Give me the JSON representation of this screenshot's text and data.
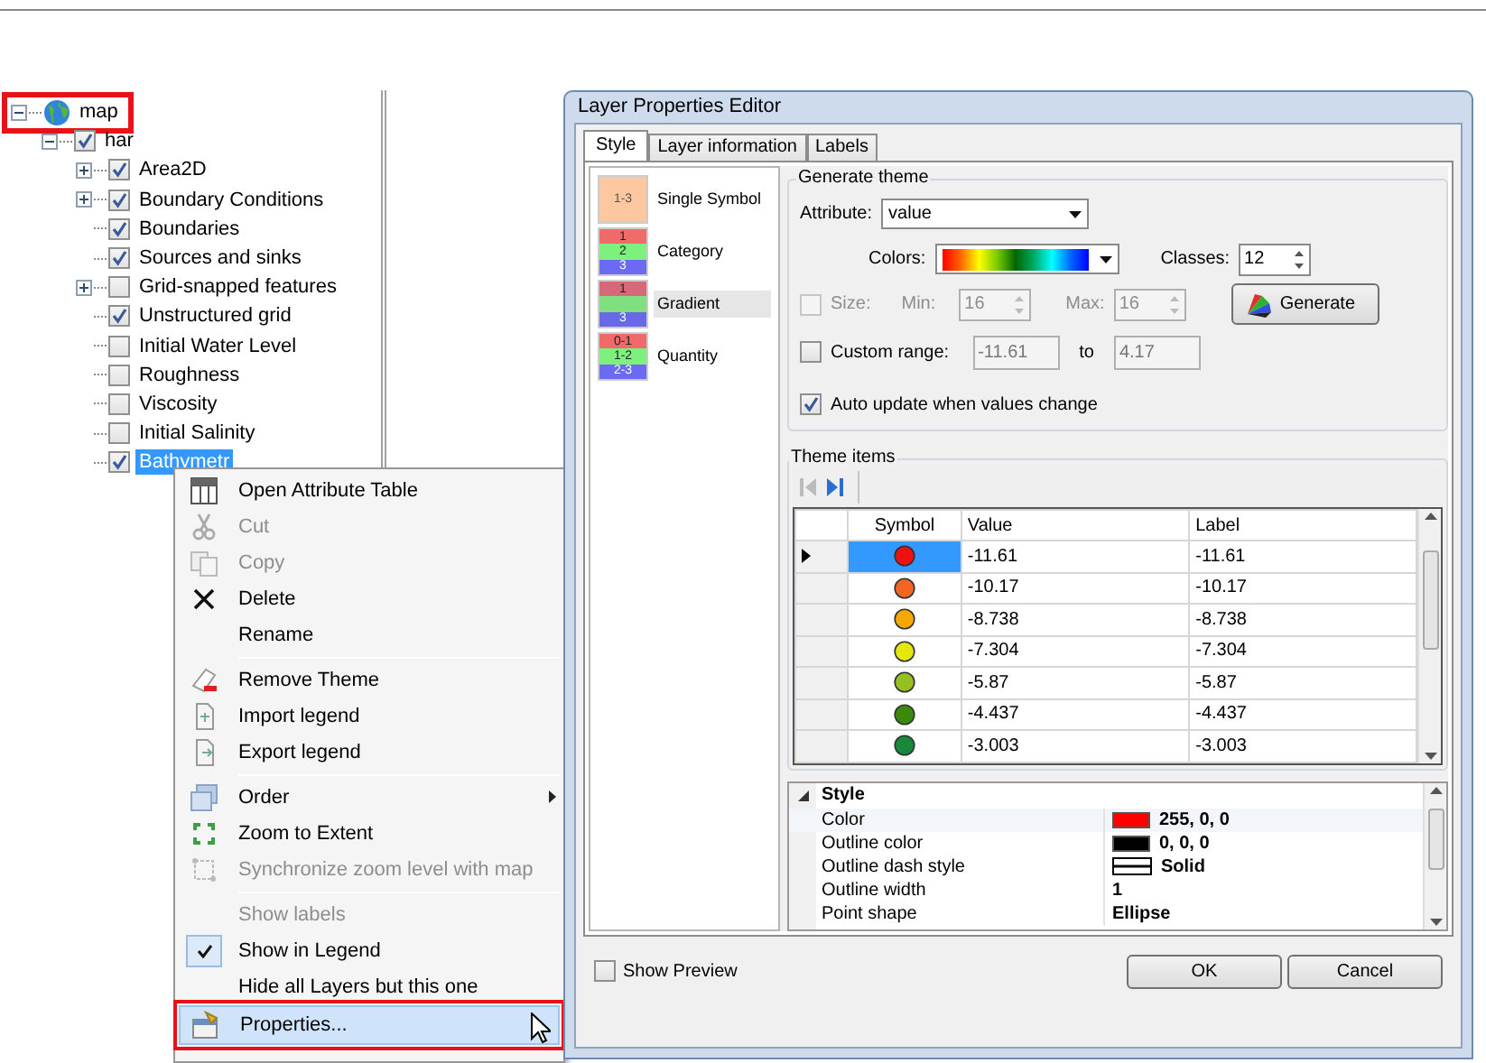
{
  "tree": {
    "nodes": [
      {
        "label": "map",
        "kind": "map",
        "expanded": true,
        "callout": true,
        "children": [
          {
            "label": "har",
            "expanded": true,
            "checked": true,
            "selected": false,
            "children": [
              {
                "label": "Area2D",
                "expanded": false,
                "checked": true,
                "selected": false
              },
              {
                "label": "Boundary Conditions",
                "expanded": false,
                "checked": true,
                "selected": false
              },
              {
                "label": "Boundaries",
                "checked": true,
                "selected": false
              },
              {
                "label": "Sources and sinks",
                "checked": true,
                "selected": false
              },
              {
                "label": "Grid-snapped features",
                "expanded": false,
                "checked": false,
                "selected": false
              },
              {
                "label": "Unstructured grid",
                "checked": true,
                "selected": false
              },
              {
                "label": "Initial Water Level",
                "checked": false,
                "selected": false
              },
              {
                "label": "Roughness",
                "checked": false,
                "selected": false
              },
              {
                "label": "Viscosity",
                "checked": false,
                "selected": false
              },
              {
                "label": "Initial Salinity",
                "checked": false,
                "selected": false
              },
              {
                "label": "Bathymetr",
                "checked": true,
                "selected": true
              }
            ]
          }
        ]
      }
    ]
  },
  "context_menu": {
    "items": [
      {
        "kind": "item",
        "label": "Open Attribute Table",
        "disabled": false,
        "checked": false,
        "selected": false
      },
      {
        "kind": "item",
        "label": "Cut",
        "disabled": true,
        "checked": false,
        "selected": false
      },
      {
        "kind": "item",
        "label": "Copy",
        "disabled": true,
        "checked": false,
        "selected": false
      },
      {
        "kind": "item",
        "label": "Delete",
        "disabled": false,
        "checked": false,
        "selected": false
      },
      {
        "kind": "item",
        "label": "Rename",
        "disabled": false,
        "checked": false,
        "selected": false
      },
      {
        "kind": "separator"
      },
      {
        "kind": "item",
        "label": "Remove Theme",
        "disabled": false,
        "checked": false,
        "selected": false
      },
      {
        "kind": "item",
        "label": "Import legend",
        "disabled": false,
        "checked": false,
        "selected": false
      },
      {
        "kind": "item",
        "label": "Export legend",
        "disabled": false,
        "checked": false,
        "selected": false
      },
      {
        "kind": "separator"
      },
      {
        "kind": "item",
        "label": "Order",
        "disabled": false,
        "checked": false,
        "selected": false,
        "submenu": true
      },
      {
        "kind": "item",
        "label": "Zoom to Extent",
        "disabled": false,
        "checked": false,
        "selected": false
      },
      {
        "kind": "item",
        "label": "Synchronize zoom level with map",
        "disabled": true,
        "checked": false,
        "selected": false
      },
      {
        "kind": "separator"
      },
      {
        "kind": "item",
        "label": "Show labels",
        "disabled": true,
        "checked": false,
        "selected": false
      },
      {
        "kind": "item",
        "label": "Show in Legend",
        "disabled": false,
        "checked": true,
        "selected": false
      },
      {
        "kind": "item",
        "label": "Hide all Layers but this one",
        "disabled": false,
        "checked": false,
        "selected": false
      },
      {
        "kind": "item",
        "label": "Properties...",
        "disabled": false,
        "checked": false,
        "selected": true,
        "callout": true
      }
    ]
  },
  "dialog": {
    "title": "Layer Properties Editor",
    "tabs": [
      {
        "label": "Style",
        "selected": true
      },
      {
        "label": "Layer information",
        "selected": false
      },
      {
        "label": "Labels",
        "selected": false
      }
    ],
    "theme_types": [
      {
        "label": "Single Symbol",
        "kind": "single",
        "swatch": [
          "1-3"
        ],
        "selected": false
      },
      {
        "label": "Category",
        "kind": "category",
        "swatch": [
          "1",
          "2",
          "3"
        ],
        "selected": false
      },
      {
        "label": "Gradient",
        "kind": "gradient",
        "swatch": [
          "1",
          "3"
        ],
        "selected": true
      },
      {
        "label": "Quantity",
        "kind": "quantity",
        "swatch": [
          "0-1",
          "1-2",
          "2-3"
        ],
        "selected": false
      }
    ],
    "generate_theme": {
      "title": "Generate theme",
      "attribute_label": "Attribute:",
      "attribute_value": "value",
      "colors_label": "Colors:",
      "classes_label": "Classes:",
      "classes_value": "12",
      "size": {
        "label": "Size:",
        "checked": false,
        "disabled": true
      },
      "min_label": "Min:",
      "min_value": "16",
      "max_label": "Max:",
      "max_value": "16",
      "generate_button": "Generate",
      "custom_range": {
        "label": "Custom range:",
        "checked": false,
        "from": "-11.61",
        "to_label": "to",
        "to": "4.17"
      },
      "auto_update": {
        "label": "Auto update when values change",
        "checked": true
      }
    },
    "theme_items": {
      "title": "Theme items",
      "columns": [
        "Symbol",
        "Value",
        "Label"
      ],
      "rows": [
        {
          "color": "#ee1111",
          "value": "-11.61",
          "label": "-11.61",
          "selected": true
        },
        {
          "color": "#f26522",
          "value": "-10.17",
          "label": "-10.17",
          "selected": false
        },
        {
          "color": "#f7a800",
          "value": "-8.738",
          "label": "-8.738",
          "selected": false
        },
        {
          "color": "#e4e80a",
          "value": "-7.304",
          "label": "-7.304",
          "selected": false
        },
        {
          "color": "#94c11f",
          "value": "-5.87",
          "label": "-5.87",
          "selected": false
        },
        {
          "color": "#3a8a0c",
          "value": "-4.437",
          "label": "-4.437",
          "selected": false
        },
        {
          "color": "#16893a",
          "value": "-3.003",
          "label": "-3.003",
          "selected": false
        }
      ]
    },
    "properties": {
      "category": "Style",
      "expanded": true,
      "rows": [
        {
          "name": "Color",
          "kind": "color",
          "color": "#ff0000",
          "value": "255, 0, 0",
          "selected": true
        },
        {
          "name": "Outline color",
          "kind": "color",
          "color": "#000000",
          "value": "0, 0, 0",
          "selected": false
        },
        {
          "name": "Outline dash style",
          "kind": "dash",
          "value": "Solid",
          "selected": false
        },
        {
          "name": "Outline width",
          "kind": "text",
          "value": "1",
          "selected": false
        },
        {
          "name": "Point shape",
          "kind": "text",
          "value": "Ellipse",
          "selected": false
        }
      ]
    },
    "show_preview": {
      "label": "Show Preview",
      "checked": false
    },
    "buttons": [
      "OK",
      "Cancel"
    ]
  }
}
